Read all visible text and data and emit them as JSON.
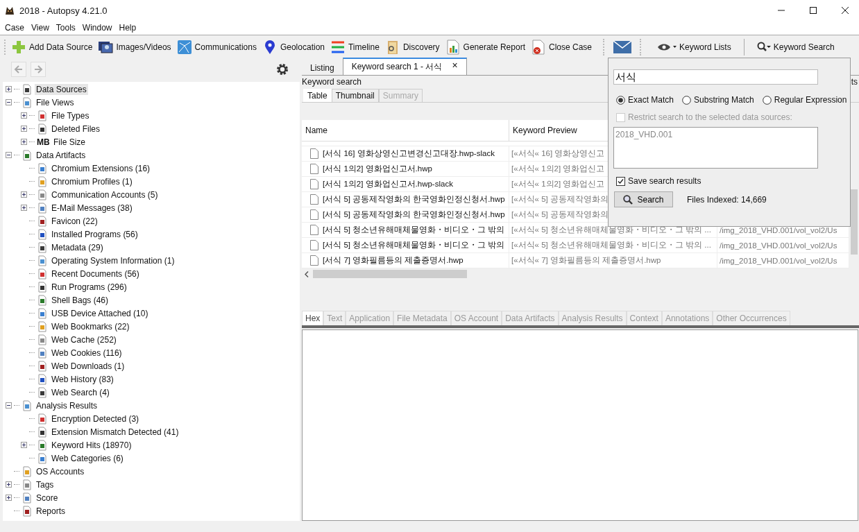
{
  "window": {
    "title": "2018 - Autopsy 4.21.0"
  },
  "menu": [
    "Case",
    "View",
    "Tools",
    "Window",
    "Help"
  ],
  "toolbar": [
    {
      "label": "Add Data Source"
    },
    {
      "label": "Images/Videos"
    },
    {
      "label": "Communications"
    },
    {
      "label": "Geolocation"
    },
    {
      "label": "Timeline"
    },
    {
      "label": "Discovery"
    },
    {
      "label": "Generate Report"
    },
    {
      "label": "Close Case"
    }
  ],
  "keyword_lists": {
    "label": "Keyword Lists"
  },
  "keyword_search": {
    "label": "Keyword Search"
  },
  "tree": [
    {
      "label": "Data Sources",
      "expanded": false,
      "selected": true
    },
    {
      "label": "File Views",
      "expanded": true,
      "selected": false,
      "children": [
        {
          "label": "File Types",
          "expanded": false,
          "selected": false
        },
        {
          "label": "Deleted Files",
          "expanded": false,
          "selected": false
        },
        {
          "label": "File Size",
          "expanded": false,
          "selected": false,
          "badge": "MB"
        }
      ]
    },
    {
      "label": "Data Artifacts",
      "expanded": true,
      "selected": false,
      "children": [
        {
          "label": "Chromium Extensions (16)",
          "selected": false
        },
        {
          "label": "Chromium Profiles (1)",
          "selected": false
        },
        {
          "label": "Communication Accounts (5)",
          "expanded": false,
          "selected": false
        },
        {
          "label": "E-Mail Messages (38)",
          "expanded": false,
          "selected": false
        },
        {
          "label": "Favicon (22)",
          "selected": false
        },
        {
          "label": "Installed Programs (56)",
          "selected": false
        },
        {
          "label": "Metadata (29)",
          "selected": false
        },
        {
          "label": "Operating System Information (1)",
          "selected": false
        },
        {
          "label": "Recent Documents (56)",
          "selected": false
        },
        {
          "label": "Run Programs (296)",
          "selected": false
        },
        {
          "label": "Shell Bags (46)",
          "selected": false
        },
        {
          "label": "USB Device Attached (10)",
          "selected": false
        },
        {
          "label": "Web Bookmarks (22)",
          "selected": false
        },
        {
          "label": "Web Cache (252)",
          "selected": false
        },
        {
          "label": "Web Cookies (116)",
          "selected": false
        },
        {
          "label": "Web Downloads (1)",
          "selected": false
        },
        {
          "label": "Web History (83)",
          "selected": false
        },
        {
          "label": "Web Search (4)",
          "selected": false
        }
      ]
    },
    {
      "label": "Analysis Results",
      "expanded": true,
      "selected": false,
      "children": [
        {
          "label": "Encryption Detected (3)",
          "selected": false
        },
        {
          "label": "Extension Mismatch Detected (41)",
          "selected": false
        },
        {
          "label": "Keyword Hits (18970)",
          "expanded": false,
          "selected": false
        },
        {
          "label": "Web Categories (6)",
          "selected": false
        }
      ]
    },
    {
      "label": "OS Accounts",
      "selected": false
    },
    {
      "label": "Tags",
      "expanded": false,
      "selected": false
    },
    {
      "label": "Score",
      "expanded": false,
      "selected": false
    },
    {
      "label": "Reports",
      "selected": false
    }
  ],
  "result_tabs": [
    {
      "label": "Listing",
      "selected": false
    },
    {
      "label": "Keyword search 1 - 서식",
      "selected": true,
      "close": "×"
    }
  ],
  "panel_title": "Keyword search",
  "panel_right_fragment": "ts",
  "view_tabs": [
    {
      "label": "Table",
      "selected": true,
      "disabled": false
    },
    {
      "label": "Thumbnail",
      "selected": false,
      "disabled": false
    },
    {
      "label": "Summary",
      "selected": false,
      "disabled": true
    }
  ],
  "table": {
    "columns": [
      "Name",
      "Keyword Preview"
    ],
    "rows": [
      {
        "name": "[서식 16] 영화상영신고변경신고대장.hwp-slack",
        "preview": "[«서식« 16] 영화상영신고"
      },
      {
        "name": "[서식 1의2] 영화업신고서.hwp",
        "preview": "[«서식« 1의2] 영화업신고"
      },
      {
        "name": "[서식 1의2] 영화업신고서.hwp-slack",
        "preview": "[«서식« 1의2] 영화업신고"
      },
      {
        "name": "[서식 5] 공동제작영화의 한국영화인정신청서.hwp",
        "preview": "[«서식« 5] 공동제작영화의"
      },
      {
        "name": "[서식 5] 공동제작영화의 한국영화인정신청서.hwp",
        "preview": "[«서식« 5] 공동제작영화의"
      },
      {
        "name": "[서식 5] 청소년유해매체물영화・비디오・그 밖의",
        "preview": "[«서식« 5] 청소년유해매체물영화・비디오・그 밖의 ...",
        "path": "/img_2018_VHD.001/vol_vol2/Us"
      },
      {
        "name": "[서식 5] 청소년유해매체물영화・비디오・그 밖의",
        "preview": "[«서식« 5] 청소년유해매체물영화・비디오・그 밖의 ...",
        "path": "/img_2018_VHD.001/vol_vol2/Us"
      },
      {
        "name": "[서식 7] 영화필름등의 제출증명서.hwp",
        "preview": "[«서식« 7] 영화필름등의 제출증명서.hwp",
        "path": "/img_2018_VHD.001/vol_vol2/Us"
      }
    ]
  },
  "content_tabs": [
    {
      "label": "Hex",
      "selected": true,
      "disabled": false
    },
    {
      "label": "Text",
      "selected": false,
      "disabled": true
    },
    {
      "label": "Application",
      "selected": false,
      "disabled": true
    },
    {
      "label": "File Metadata",
      "selected": false,
      "disabled": true
    },
    {
      "label": "OS Account",
      "selected": false,
      "disabled": true
    },
    {
      "label": "Data Artifacts",
      "selected": false,
      "disabled": true
    },
    {
      "label": "Analysis Results",
      "selected": false,
      "disabled": true
    },
    {
      "label": "Context",
      "selected": false,
      "disabled": true
    },
    {
      "label": "Annotations",
      "selected": false,
      "disabled": true
    },
    {
      "label": "Other Occurrences",
      "selected": false,
      "disabled": true
    }
  ],
  "search_popup": {
    "query": "서식",
    "match_types": [
      {
        "label": "Exact Match",
        "selected": true
      },
      {
        "label": "Substring Match",
        "selected": false
      },
      {
        "label": "Regular Expression",
        "selected": false
      }
    ],
    "restrict": {
      "label": "Restrict search to the selected data sources:",
      "checked": false,
      "disabled": true
    },
    "data_sources": [
      "2018_VHD.001"
    ],
    "save_results": {
      "label": "Save search results",
      "checked": true
    },
    "search_button": "Search",
    "files_indexed": "Files Indexed: 14,669"
  }
}
